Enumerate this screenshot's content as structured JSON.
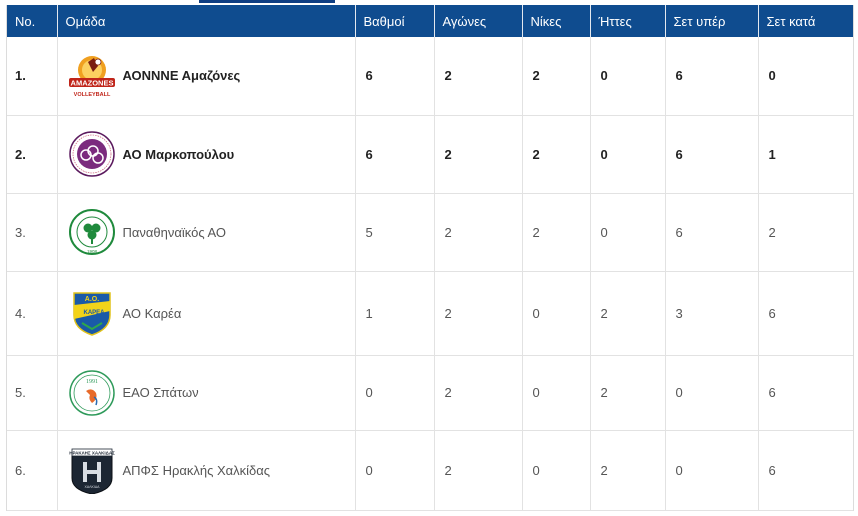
{
  "headers": {
    "no": "No.",
    "team": "Ομάδα",
    "points": "Βαθμοί",
    "games": "Αγώνες",
    "wins": "Νίκες",
    "losses": "Ήττες",
    "sets_for": "Σετ υπέρ",
    "sets_against": "Σετ κατά"
  },
  "rows": [
    {
      "pos": "1.",
      "team": "ΑΟΝΝΝΕ Αμαζόνες",
      "points": "6",
      "games": "2",
      "wins": "2",
      "losses": "0",
      "sets_for": "6",
      "sets_against": "0",
      "logo": "amazones-logo",
      "logo_text": "AMAZONES",
      "logo_subtext": "VOLLEYBALL"
    },
    {
      "pos": "2.",
      "team": "ΑΟ Μαρκοπούλου",
      "points": "6",
      "games": "2",
      "wins": "2",
      "losses": "0",
      "sets_for": "6",
      "sets_against": "1",
      "logo": "markopoulo-logo"
    },
    {
      "pos": "3.",
      "team": "Παναθηναϊκός ΑΟ",
      "points": "5",
      "games": "2",
      "wins": "2",
      "losses": "0",
      "sets_for": "6",
      "sets_against": "2",
      "logo": "panathinaikos-logo",
      "logo_text": "ΠΑΝΑΘΗΝΑΪΚΟΣ Α.Ο.",
      "logo_subtext": "1908"
    },
    {
      "pos": "4.",
      "team": "ΑΟ Καρέα",
      "points": "1",
      "games": "2",
      "wins": "0",
      "losses": "2",
      "sets_for": "3",
      "sets_against": "6",
      "logo": "karea-logo",
      "logo_text": "Α.Ο.",
      "logo_subtext": "ΚΑΡΕΑ"
    },
    {
      "pos": "5.",
      "team": "ΕΑΟ Σπάτων",
      "points": "0",
      "games": "2",
      "wins": "0",
      "losses": "2",
      "sets_for": "0",
      "sets_against": "6",
      "logo": "spata-logo",
      "logo_text": "1991"
    },
    {
      "pos": "6.",
      "team": "ΑΠΦΣ Ηρακλής Χαλκίδας",
      "points": "0",
      "games": "2",
      "wins": "0",
      "losses": "2",
      "sets_for": "0",
      "sets_against": "6",
      "logo": "iraklis-logo",
      "logo_text": "ΗΡΑΚΛΗΣ ΧΑΛΚΙΔΑΣ",
      "logo_subtext": "ΧΑΛΚΙΔΑ"
    }
  ],
  "colors": {
    "header_bg": "#0f4c8f",
    "header_text": "#ffffff",
    "grid": "#e2e2e2"
  }
}
